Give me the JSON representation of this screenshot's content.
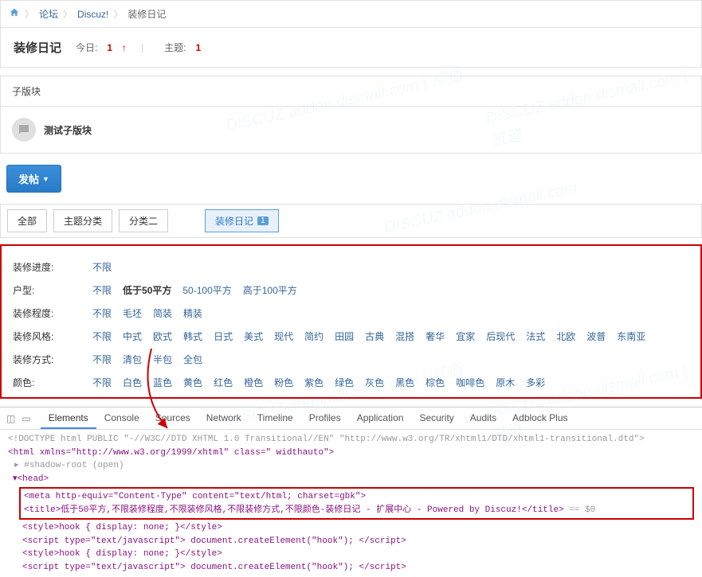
{
  "breadcrumb": {
    "home": "⌂",
    "forum": "论坛",
    "discuz": "Discuz!",
    "current": "装修日记"
  },
  "header": {
    "title": "装修日记",
    "today_label": "今日:",
    "today_count": "1",
    "topic_label": "主题:",
    "topic_count": "1"
  },
  "subblock": {
    "header": "子版块",
    "item": "测试子版块"
  },
  "post_btn": {
    "label": "发帖",
    "caret": "▼"
  },
  "tabs": {
    "all": "全部",
    "topic_class": "主题分类",
    "class2": "分类二",
    "active": "装修日记",
    "badge": "1"
  },
  "filters": {
    "progress": {
      "label": "装修进度:",
      "opts": [
        "不限"
      ]
    },
    "type": {
      "label": "户型:",
      "opts": [
        "不限",
        "低于50平方",
        "50-100平方",
        "高于100平方"
      ],
      "selected": 1
    },
    "degree": {
      "label": "装修程度:",
      "opts": [
        "不限",
        "毛坯",
        "简装",
        "精装"
      ]
    },
    "style": {
      "label": "装修风格:",
      "opts": [
        "不限",
        "中式",
        "欧式",
        "韩式",
        "日式",
        "美式",
        "现代",
        "简约",
        "田园",
        "古典",
        "混搭",
        "奢华",
        "宜家",
        "后现代",
        "法式",
        "北欧",
        "波普",
        "东南亚"
      ]
    },
    "method": {
      "label": "装修方式:",
      "opts": [
        "不限",
        "清包",
        "半包",
        "全包"
      ]
    },
    "color": {
      "label": "颜色:",
      "opts": [
        "不限",
        "白色",
        "蓝色",
        "黄色",
        "红色",
        "橙色",
        "粉色",
        "紫色",
        "绿色",
        "灰色",
        "黑色",
        "棕色",
        "咖啡色",
        "原木",
        "多彩"
      ]
    }
  },
  "devtools": {
    "tabs": [
      "Elements",
      "Console",
      "Sources",
      "Network",
      "Timeline",
      "Profiles",
      "Application",
      "Security",
      "Audits",
      "Adblock Plus"
    ],
    "active_tab": 0,
    "doctype": "<!DOCTYPE html PUBLIC \"-//W3C//DTD XHTML 1.0 Transitional//EN\" \"http://www.w3.org/TR/xhtml1/DTD/xhtml1-transitional.dtd\">",
    "html_tag": "<html xmlns=\"http://www.w3.org/1999/xhtml\" class=\" widthauto\">",
    "shadow": "▸ #shadow-root (open)",
    "head_open": "▾<head>",
    "meta_line": "<meta http-equiv=\"Content-Type\" content=\"text/html; charset=gbk\">",
    "title_line": "<title>低于50平方,不限装修程度,不限装修风格,不限装修方式,不限颜色-装修日记 -  扩展中心 -  Powered by Discuz!</title>",
    "title_suffix": " == $0",
    "extra1": "<style>hook { display: none; }</style>",
    "extra2": "<script type=\"text/javascript\"> document.createElement(\"hook\"); </script>",
    "extra3": "<style>hook { display: none; }</style>",
    "extra4": "<script type=\"text/javascript\"> document.createElement(\"hook\"); </script>"
  }
}
